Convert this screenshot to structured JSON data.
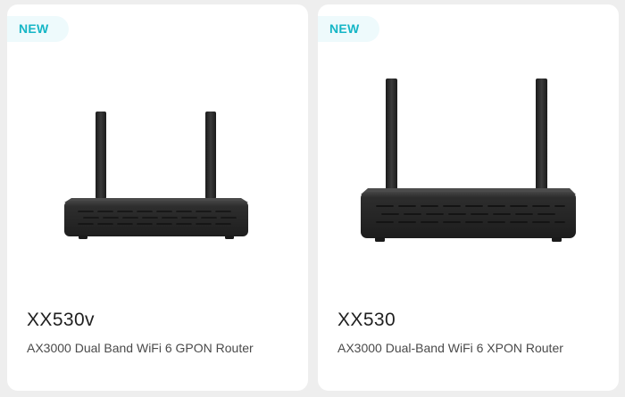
{
  "products": [
    {
      "badge": "NEW",
      "image_icon": "router-icon",
      "model": "XX530v",
      "description": "AX3000 Dual Band WiFi 6 GPON Router"
    },
    {
      "badge": "NEW",
      "image_icon": "router-icon",
      "model": "XX530",
      "description": "AX3000 Dual-Band WiFi 6 XPON Router"
    }
  ],
  "colors": {
    "page_background": "#eeeeee",
    "card_background": "#ffffff",
    "badge_background": "#eefafc",
    "badge_text": "#16b6c6",
    "model_text": "#1f1f1f",
    "description_text": "#4a4a4a",
    "router_body": "#2b2b2b"
  }
}
